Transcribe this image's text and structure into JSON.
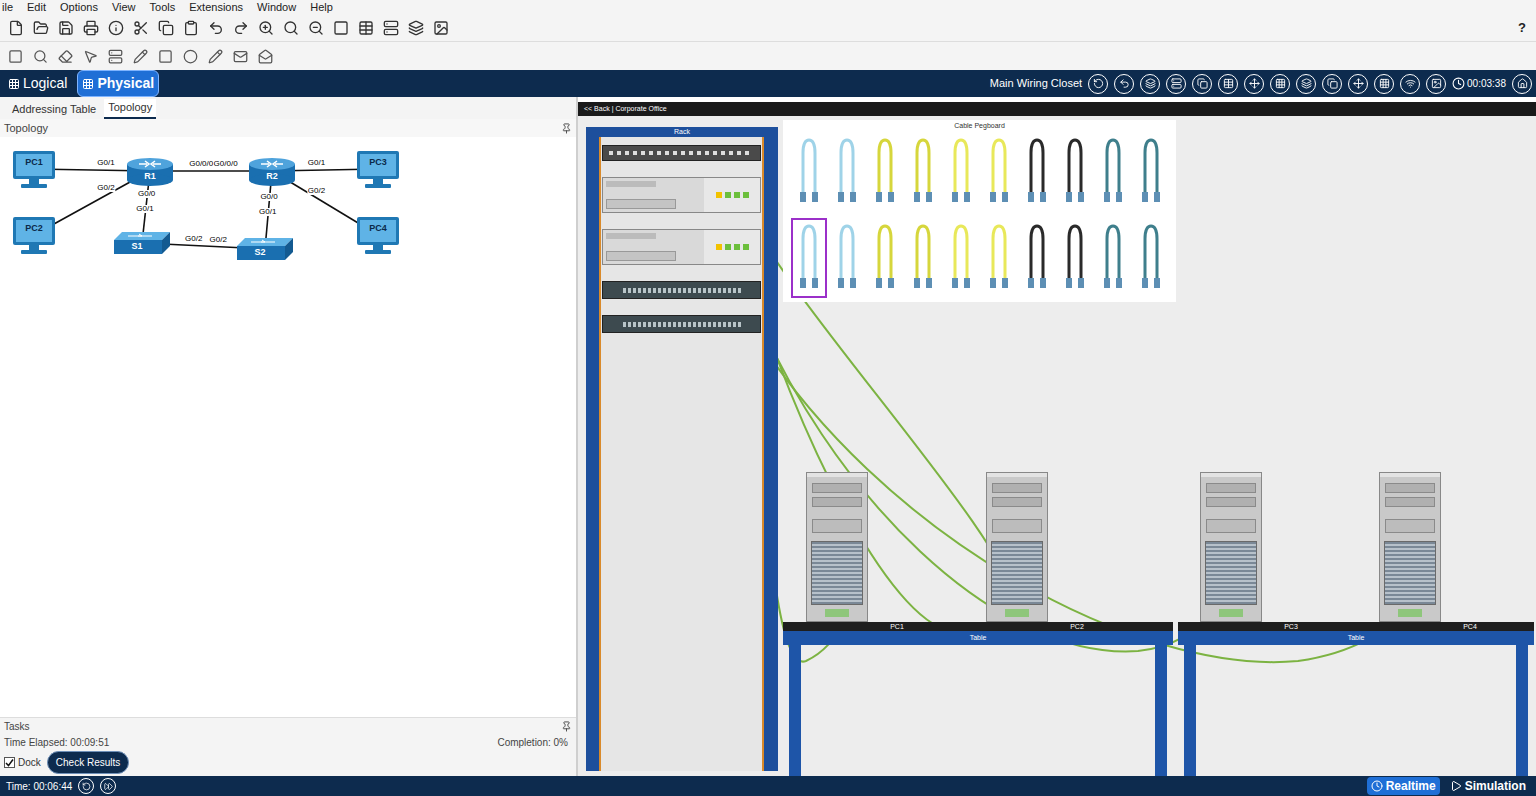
{
  "menu": [
    "ile",
    "Edit",
    "Options",
    "View",
    "Tools",
    "Extensions",
    "Window",
    "Help"
  ],
  "help_button": "?",
  "view_tabs": [
    {
      "label": "Logical",
      "selected": false
    },
    {
      "label": "Physical",
      "selected": true
    }
  ],
  "location": "Main Wiring Closet",
  "clock": "00:03:38",
  "left_panel": {
    "tabs": [
      {
        "label": "Addressing Table",
        "selected": false
      },
      {
        "label": "Topology",
        "selected": true
      }
    ],
    "title": "Topology",
    "topology": {
      "nodes": [
        {
          "label": "PC1",
          "kind": "pc"
        },
        {
          "label": "PC2",
          "kind": "pc"
        },
        {
          "label": "R1",
          "kind": "router"
        },
        {
          "label": "R2",
          "kind": "router"
        },
        {
          "label": "S1",
          "kind": "switch"
        },
        {
          "label": "S2",
          "kind": "switch"
        },
        {
          "label": "PC3",
          "kind": "pc"
        },
        {
          "label": "PC4",
          "kind": "pc"
        }
      ],
      "links": [
        {
          "from": "PC1",
          "to": "R1",
          "to_port": "G0/1"
        },
        {
          "from": "PC2",
          "to": "R1",
          "to_port": "G0/2"
        },
        {
          "from": "R1",
          "to": "R2",
          "from_port": "G0/0/0",
          "to_port": "G0/0/0"
        },
        {
          "from": "R1",
          "to": "S1",
          "from_port": "G0/0",
          "to_port": "G0/1"
        },
        {
          "from": "S1",
          "to": "S2",
          "from_port": "G0/2",
          "to_port": "G0/2"
        },
        {
          "from": "R2",
          "to": "S2",
          "from_port": "G0/0",
          "to_port": "G0/1"
        },
        {
          "from": "R2",
          "to": "PC3",
          "from_port": "G0/1"
        },
        {
          "from": "R2",
          "to": "PC4",
          "from_port": "G0/2"
        }
      ]
    }
  },
  "tasks": {
    "title": "Tasks",
    "elapsed": "Time Elapsed: 00:09:51",
    "completion": "Completion: 0%",
    "dock": {
      "label": "Dock",
      "checked": true
    },
    "button": "Check Results"
  },
  "workspace": {
    "path": "<< Back | Corporate Office",
    "rack": {
      "label": "Rack",
      "devices": [
        {
          "kind": "patch-panel"
        },
        {
          "kind": "router"
        },
        {
          "kind": "router"
        },
        {
          "kind": "switch"
        },
        {
          "kind": "switch"
        }
      ]
    },
    "pegboard": {
      "title": "Cable Pegboard",
      "cables": [
        {
          "color": "#9fd3e8",
          "selected": false
        },
        {
          "color": "#9fd3e8",
          "selected": false
        },
        {
          "color": "#d6d63c",
          "selected": false
        },
        {
          "color": "#d6d63c",
          "selected": false
        },
        {
          "color": "#e8e85a",
          "selected": false
        },
        {
          "color": "#e8e85a",
          "selected": false
        },
        {
          "color": "#2a2a2a",
          "selected": false
        },
        {
          "color": "#2a2a2a",
          "selected": false
        },
        {
          "color": "#3f7f8c",
          "selected": false
        },
        {
          "color": "#3f7f8c",
          "selected": false
        },
        {
          "color": "#9fd3e8",
          "selected": true
        },
        {
          "color": "#9fd3e8",
          "selected": false
        },
        {
          "color": "#d6d63c",
          "selected": false
        },
        {
          "color": "#d6d63c",
          "selected": false
        },
        {
          "color": "#e8e85a",
          "selected": false
        },
        {
          "color": "#e8e85a",
          "selected": false
        },
        {
          "color": "#2a2a2a",
          "selected": false
        },
        {
          "color": "#2a2a2a",
          "selected": false
        },
        {
          "color": "#3f7f8c",
          "selected": false
        },
        {
          "color": "#3f7f8c",
          "selected": false
        }
      ]
    },
    "tables": [
      {
        "label": "Table",
        "pcs": [
          "PC1",
          "PC2"
        ]
      },
      {
        "label": "Table",
        "pcs": [
          "PC3",
          "PC4"
        ]
      }
    ]
  },
  "status_bar": {
    "time": "Time: 00:06:44",
    "modes": [
      {
        "label": "Realtime",
        "selected": true
      },
      {
        "label": "Simulation",
        "selected": false
      }
    ]
  }
}
